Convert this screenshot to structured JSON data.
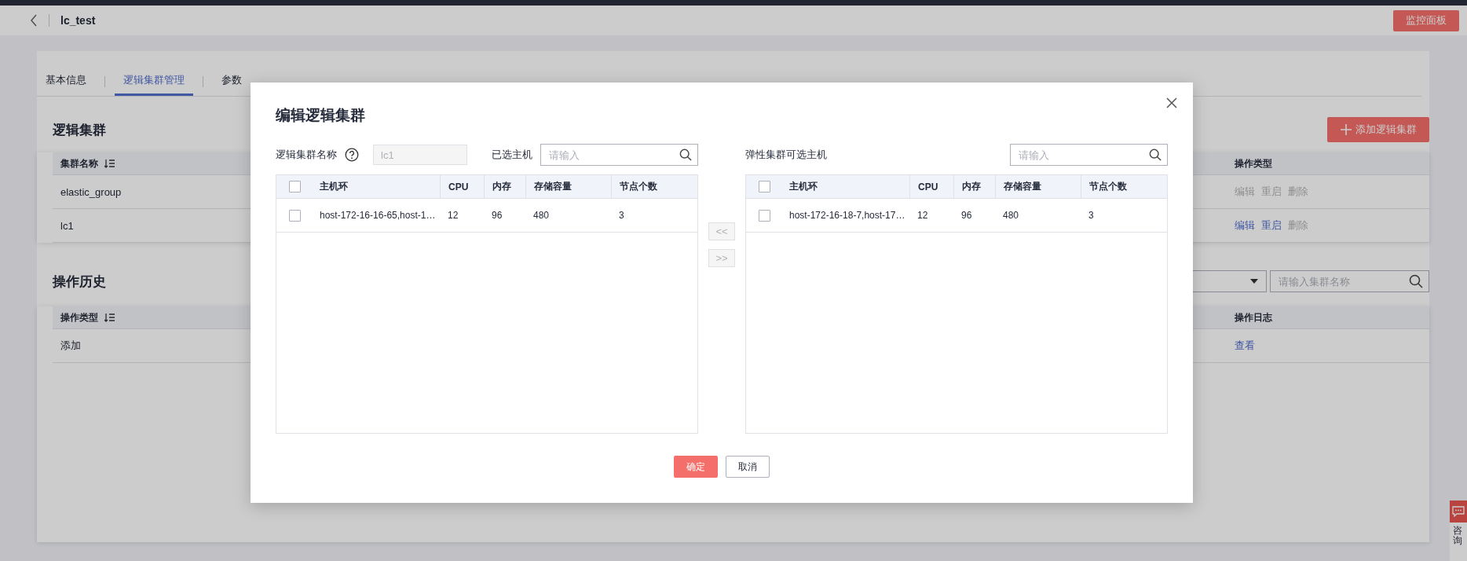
{
  "header": {
    "title": "lc_test",
    "monitor_button": "监控面板"
  },
  "tabs": [
    {
      "label": "基本信息",
      "selected": false
    },
    {
      "label": "逻辑集群管理",
      "selected": true
    },
    {
      "label": "参数",
      "selected": false
    }
  ],
  "logic_clusters": {
    "title": "逻辑集群",
    "add_button": "添加逻辑集群",
    "columns": [
      {
        "label": "集群名称",
        "sortable": true
      },
      {
        "label": "操作类型",
        "sortable": false
      }
    ],
    "rows": [
      {
        "name": "elastic_group",
        "actions": [
          {
            "label": "编辑",
            "disabled": true
          },
          {
            "label": "重启",
            "disabled": true
          },
          {
            "label": "删除",
            "disabled": true
          }
        ]
      },
      {
        "name": "lc1",
        "actions": [
          {
            "label": "编辑",
            "disabled": false
          },
          {
            "label": "重启",
            "disabled": false
          },
          {
            "label": "删除",
            "disabled": true
          }
        ]
      }
    ]
  },
  "history": {
    "title": "操作历史",
    "search": {
      "placeholder": "请输入集群名称"
    },
    "columns": [
      {
        "label": "操作类型",
        "sortable": true
      },
      {
        "label": "操作日志",
        "sortable": false
      }
    ],
    "rows": [
      {
        "type": "添加",
        "log": "查看"
      }
    ]
  },
  "help_widget": {
    "label": "咨询"
  },
  "dialog": {
    "title": "编辑逻辑集群",
    "name_label": "逻辑集群名称",
    "name_value": "lc1",
    "panels": [
      {
        "label": "已选主机",
        "search": {
          "placeholder": "请输入"
        },
        "select_all_checked": false,
        "columns": [
          "主机环",
          "CPU",
          "内存",
          "存储容量",
          "节点个数"
        ],
        "rows": [
          {
            "host": "host-172-16-16-65,host-1…",
            "cpu": "12",
            "memory": "96",
            "storage": "480",
            "nodes": "3",
            "checked": false
          }
        ]
      },
      {
        "label": "弹性集群可选主机",
        "search": {
          "placeholder": "请输入"
        },
        "select_all_checked": false,
        "columns": [
          "主机环",
          "CPU",
          "内存",
          "存储容量",
          "节点个数"
        ],
        "rows": [
          {
            "host": "host-172-16-18-7,host-17…",
            "cpu": "12",
            "memory": "96",
            "storage": "480",
            "nodes": "3",
            "checked": false
          }
        ]
      }
    ],
    "transfer_buttons": [
      {
        "label": "<<",
        "disabled": true
      },
      {
        "label": ">>",
        "disabled": true
      }
    ],
    "confirm_button": "确定",
    "cancel_button": "取消"
  }
}
